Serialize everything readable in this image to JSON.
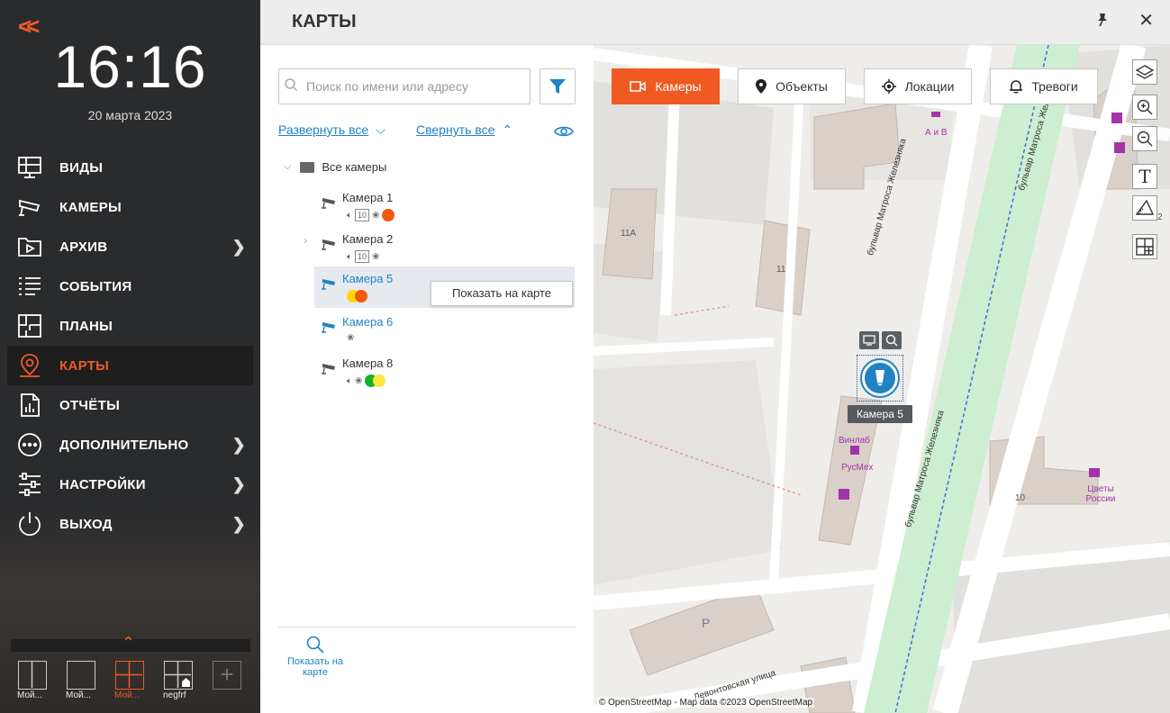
{
  "sidebar": {
    "clock": "16:16",
    "date": "20 марта 2023",
    "items": [
      {
        "label": "ВИДЫ",
        "icon": "monitor-grid-icon",
        "chevron": false,
        "active": false
      },
      {
        "label": "КАМЕРЫ",
        "icon": "camera-icon",
        "chevron": false,
        "active": false
      },
      {
        "label": "АРХИВ",
        "icon": "archive-folder-icon",
        "chevron": true,
        "active": false
      },
      {
        "label": "СОБЫТИЯ",
        "icon": "events-list-icon",
        "chevron": false,
        "active": false
      },
      {
        "label": "ПЛАНЫ",
        "icon": "floorplan-icon",
        "chevron": false,
        "active": false
      },
      {
        "label": "КАРТЫ",
        "icon": "map-pin-icon",
        "chevron": false,
        "active": true
      },
      {
        "label": "ОТЧЁТЫ",
        "icon": "report-icon",
        "chevron": false,
        "active": false
      },
      {
        "label": "ДОПОЛНИТЕЛЬНО",
        "icon": "more-icon",
        "chevron": true,
        "active": false
      },
      {
        "label": "НАСТРОЙКИ",
        "icon": "sliders-icon",
        "chevron": true,
        "active": false
      },
      {
        "label": "ВЫХОД",
        "icon": "power-icon",
        "chevron": true,
        "active": false
      }
    ],
    "layouts": [
      {
        "label": "Мой..."
      },
      {
        "label": "Мой..."
      },
      {
        "label": "Мой..."
      },
      {
        "label": "negfrf"
      }
    ]
  },
  "header": {
    "title": "КАРТЫ"
  },
  "panel": {
    "search_placeholder": "Поиск по имени или адресу",
    "expand_all": "Развернуть все",
    "collapse_all": "Свернуть все",
    "root": "Все камеры",
    "cameras": [
      {
        "name": "Камера 1",
        "badges": [
          "sound",
          "10",
          "brain"
        ],
        "dots": [
          "#f05a0a"
        ],
        "highlight": false
      },
      {
        "name": "Камера 2",
        "badges": [
          "sound",
          "10",
          "brain"
        ],
        "dots": [],
        "highlight": false
      },
      {
        "name": "Камера 5",
        "badges": [],
        "dots": [
          "#ffd800",
          "#f05a0a"
        ],
        "highlight": true
      },
      {
        "name": "Камера 6",
        "badges": [
          "brain"
        ],
        "dots": [],
        "highlight": true
      },
      {
        "name": "Камера 8",
        "badges": [
          "sound",
          "brain"
        ],
        "dots": [
          "#17b026",
          "#ffe640"
        ],
        "highlight": false
      }
    ],
    "show_on_map_popup": "Показать на карте",
    "show_on_map_bottom": "Показать на карте"
  },
  "map": {
    "tabs": [
      {
        "label": "Камеры",
        "active": true
      },
      {
        "label": "Объекты",
        "active": false
      },
      {
        "label": "Локации",
        "active": false
      },
      {
        "label": "Тревоги",
        "active": false
      }
    ],
    "camera_marker_label": "Камера 5",
    "attribution": "© OpenStreetMap - Map data ©2023 OpenStreetMap",
    "labels": {
      "street1": "бульвар Матроса Железняка",
      "street2": "бульвар Матроса Железняка",
      "street3": "бульвар Матроса Железняка",
      "street4": "Левонтовская улица",
      "b11a": "11А",
      "b11": "11",
      "b10": "10",
      "b2": "2",
      "poi_aiv": "А и В",
      "poi_vinlab": "Винлаб",
      "poi_rusmeh": "РусМех",
      "poi_flowers": "Цветы России",
      "parking": "P"
    }
  },
  "colors": {
    "accent": "#f05a22",
    "link": "#1f83c5",
    "sidebar_bg": "#2a2b2d"
  }
}
